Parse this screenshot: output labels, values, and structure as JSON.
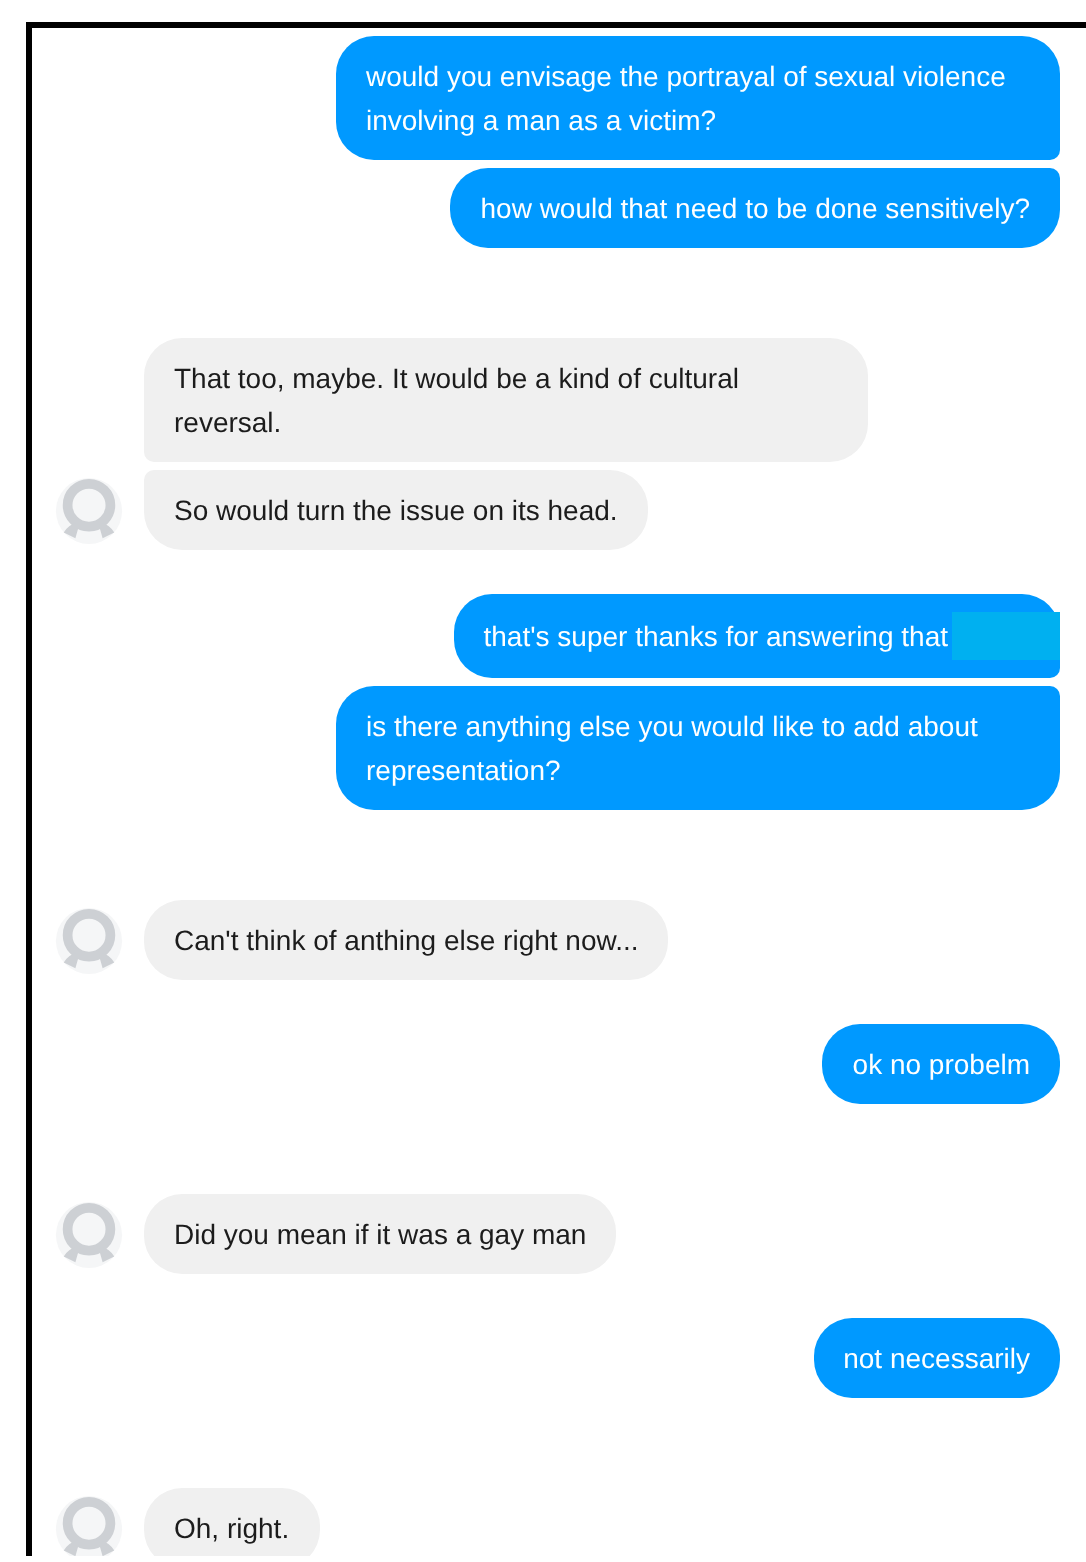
{
  "groups": [
    {
      "kind": "sent",
      "messages": [
        {
          "text": "would you envisage the portrayal of sexual violence involving a man as a victim?"
        },
        {
          "text": "how would that need to be done sensitively?"
        }
      ]
    },
    {
      "kind": "received",
      "messages": [
        {
          "text": "That too, maybe.  It would be a kind of cultural reversal."
        },
        {
          "text": "So would turn the issue on its head."
        }
      ]
    },
    {
      "kind": "sent",
      "messages": [
        {
          "text": "that's super thanks for answering that",
          "redacted": true
        },
        {
          "text": "is there anything else you would like to add about representation?"
        }
      ]
    },
    {
      "kind": "received",
      "messages": [
        {
          "text": "Can't think of anthing else right now..."
        }
      ]
    },
    {
      "kind": "sent",
      "messages": [
        {
          "text": "ok no probelm"
        }
      ]
    },
    {
      "kind": "received",
      "messages": [
        {
          "text": "Did you mean if it was a gay man"
        }
      ]
    },
    {
      "kind": "sent",
      "messages": [
        {
          "text": "not necessarily"
        }
      ]
    },
    {
      "kind": "received",
      "messages": [
        {
          "text": "Oh, right."
        }
      ]
    }
  ]
}
